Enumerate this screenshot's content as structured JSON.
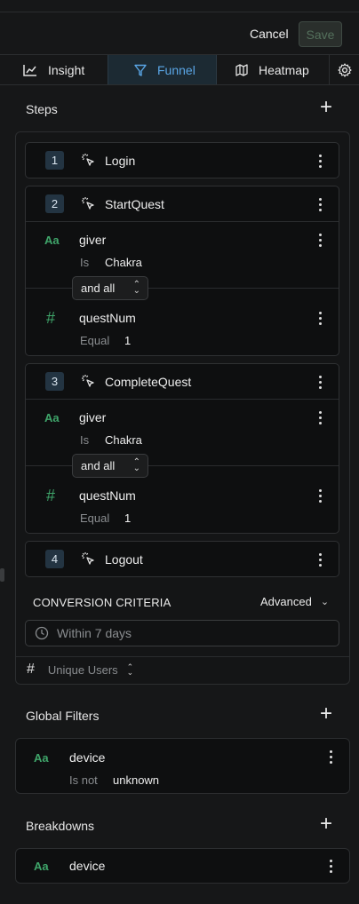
{
  "header": {
    "cancel_label": "Cancel",
    "save_label": "Save"
  },
  "tabs": [
    {
      "label": "Insight",
      "icon": "chart-icon"
    },
    {
      "label": "Funnel",
      "icon": "funnel-icon",
      "active": true
    },
    {
      "label": "Heatmap",
      "icon": "map-icon"
    }
  ],
  "steps": {
    "title": "Steps",
    "items": [
      {
        "num": "1",
        "event": "Login"
      },
      {
        "num": "2",
        "event": "StartQuest",
        "filters": [
          {
            "type": "Aa",
            "prop": "giver",
            "op": "Is",
            "value": "Chakra"
          },
          {
            "type": "#",
            "prop": "questNum",
            "op": "Equal",
            "value": "1"
          }
        ],
        "combinator": "and all"
      },
      {
        "num": "3",
        "event": "CompleteQuest",
        "filters": [
          {
            "type": "Aa",
            "prop": "giver",
            "op": "Is",
            "value": "Chakra"
          },
          {
            "type": "#",
            "prop": "questNum",
            "op": "Equal",
            "value": "1"
          }
        ],
        "combinator": "and all"
      },
      {
        "num": "4",
        "event": "Logout"
      }
    ]
  },
  "conversion": {
    "title": "CONVERSION CRITERIA",
    "mode": "Advanced",
    "window": "Within 7 days",
    "measure": "Unique Users"
  },
  "global_filters": {
    "title": "Global Filters",
    "items": [
      {
        "type": "Aa",
        "prop": "device",
        "op": "Is not",
        "value": "unknown"
      }
    ]
  },
  "breakdowns": {
    "title": "Breakdowns",
    "items": [
      {
        "type": "Aa",
        "prop": "device"
      }
    ]
  },
  "colors": {
    "accent": "#5aa6e6",
    "type_icon": "#3fa56a",
    "background": "#161718"
  }
}
